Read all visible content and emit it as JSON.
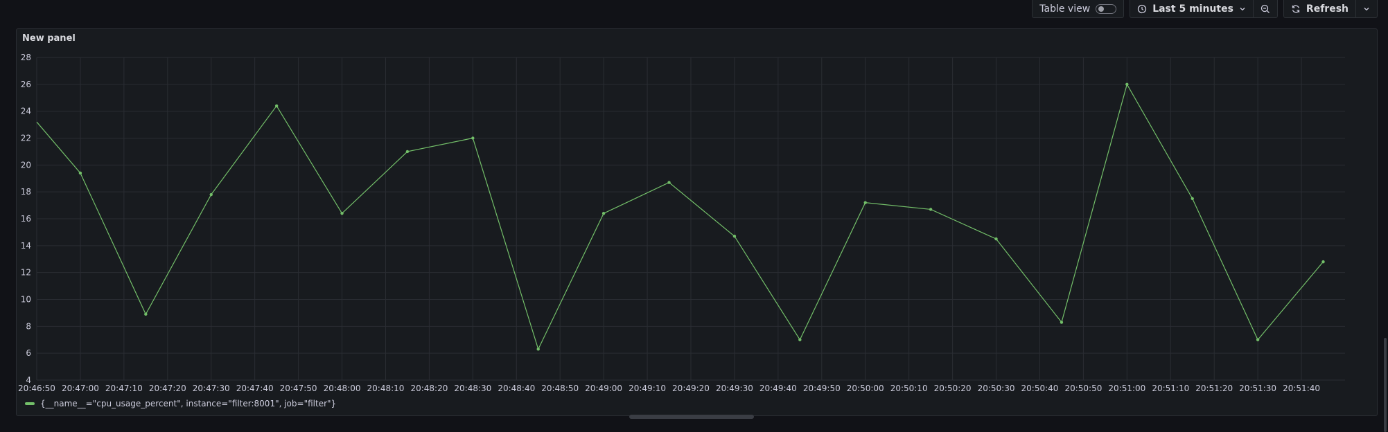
{
  "toolbar": {
    "table_view_label": "Table view",
    "table_view_on": false,
    "time_range_label": "Last 5 minutes",
    "refresh_label": "Refresh"
  },
  "panel": {
    "title": "New panel",
    "legend_label": "{__name__=\"cpu_usage_percent\", instance=\"filter:8001\", job=\"filter\"}"
  },
  "colors": {
    "series": "#73bf69",
    "background": "#111217",
    "panel": "#181b1f"
  },
  "chart_data": {
    "type": "line",
    "title": "New panel",
    "xlabel": "",
    "ylabel": "",
    "ylim": [
      4,
      28
    ],
    "y_ticks": [
      "4",
      "6",
      "8",
      "10",
      "12",
      "14",
      "16",
      "18",
      "20",
      "22",
      "24",
      "26",
      "28"
    ],
    "x_ticks": [
      "20:46:50",
      "20:47:00",
      "20:47:10",
      "20:47:20",
      "20:47:30",
      "20:47:40",
      "20:47:50",
      "20:48:00",
      "20:48:10",
      "20:48:20",
      "20:48:30",
      "20:48:40",
      "20:48:50",
      "20:49:00",
      "20:49:10",
      "20:49:20",
      "20:49:30",
      "20:49:40",
      "20:49:50",
      "20:50:00",
      "20:50:10",
      "20:50:20",
      "20:50:30",
      "20:50:40",
      "20:50:50",
      "20:51:00",
      "20:51:10",
      "20:51:20",
      "20:51:30",
      "20:51:40"
    ],
    "xlim": [
      "20:46:50",
      "20:51:50"
    ],
    "grid": true,
    "legend_position": "bottom-left",
    "series": [
      {
        "name": "{__name__=\"cpu_usage_percent\", instance=\"filter:8001\", job=\"filter\"}",
        "color": "#73bf69",
        "x": [
          "20:46:50",
          "20:47:00",
          "20:47:15",
          "20:47:30",
          "20:47:45",
          "20:48:00",
          "20:48:15",
          "20:48:30",
          "20:48:45",
          "20:49:00",
          "20:49:15",
          "20:49:30",
          "20:49:45",
          "20:50:00",
          "20:50:15",
          "20:50:30",
          "20:50:45",
          "20:51:00",
          "20:51:15",
          "20:51:30",
          "20:51:45"
        ],
        "y": [
          23.2,
          19.4,
          8.9,
          17.8,
          24.4,
          16.4,
          21.0,
          22.0,
          6.3,
          16.4,
          18.7,
          14.7,
          7.0,
          17.2,
          16.7,
          14.5,
          8.3,
          26.0,
          17.5,
          7.0,
          12.8
        ],
        "point_shown": [
          false,
          true,
          true,
          true,
          true,
          true,
          true,
          true,
          true,
          true,
          true,
          true,
          true,
          true,
          true,
          true,
          true,
          true,
          true,
          true,
          true
        ]
      }
    ]
  }
}
